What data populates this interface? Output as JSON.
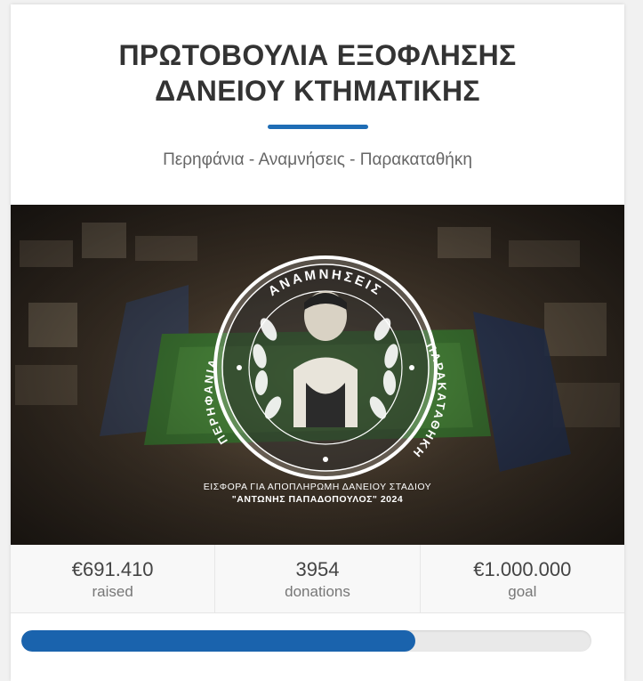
{
  "campaign": {
    "title_line1": "ΠΡΩΤΟΒΟΥΛΙΑ ΕΞΟΦΛΗΣΗΣ",
    "title_line2": "ΔΑΝΕΙΟΥ ΚΤΗΜΑΤΙΚΗΣ",
    "subtitle": "Περηφάνια - Αναμνήσεις - Παρακαταθήκη",
    "accent_color": "#1f6db5"
  },
  "hero": {
    "emblem_top": "ΑΝΑΜΝΗΣΕΙΣ",
    "emblem_left": "ΠΕΡΗΦΑΝΙΑ",
    "emblem_right": "ΠΑΡΑΚΑΤΑΘΗΚΗ",
    "caption_line1": "ΕΙΣΦΟΡΑ ΓΙΑ ΑΠΟΠΛΗΡΩΜΗ ΔΑΝΕΙΟΥ ΣΤΑΔΙΟΥ",
    "caption_line2": "\"ΑΝΤΩΝΗΣ ΠΑΠΑΔΟΠΟΥΛΟΣ\" 2024"
  },
  "stats": [
    {
      "value": "€691.410",
      "label": "raised"
    },
    {
      "value": "3954",
      "label": "donations"
    },
    {
      "value": "€1.000.000",
      "label": "goal"
    }
  ],
  "progress": {
    "fraction": 0.691,
    "color": "#1a63ad"
  }
}
